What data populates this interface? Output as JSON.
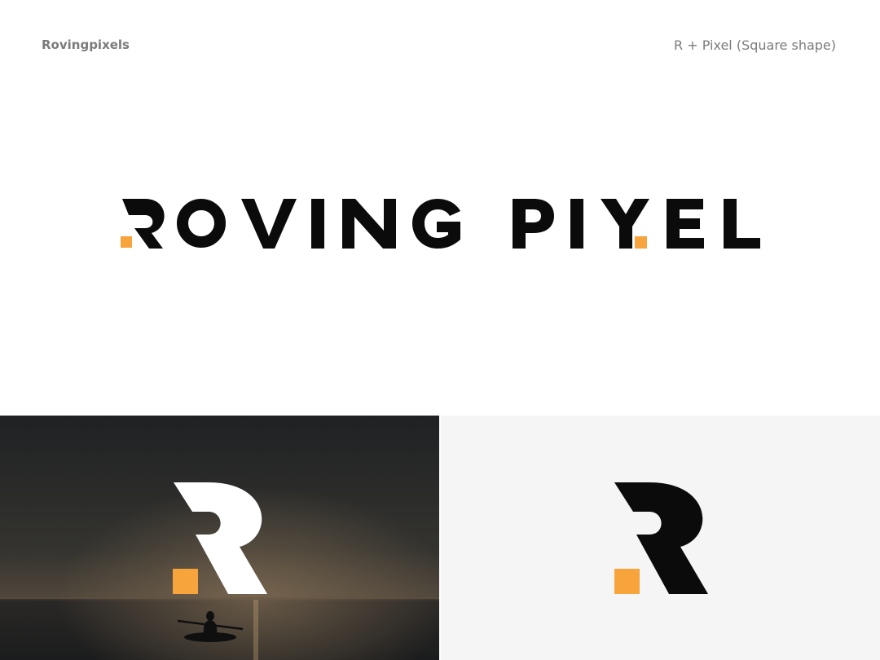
{
  "header": {
    "brand_name": "Rovingpixels",
    "concept_caption": "R + Pixel (Square shape)"
  },
  "logo": {
    "wordmark_letters": [
      "R",
      "O",
      "V",
      "I",
      "N",
      "G",
      "P",
      "I",
      "X",
      "E",
      "L"
    ],
    "monogram": "R"
  },
  "colors": {
    "accent": "#f6a43b",
    "ink": "#0b0b0b",
    "background": "#ffffff",
    "light_panel": "#f5f5f5",
    "caption_gray": "#7b7b7b"
  },
  "icons": {
    "pixel_square": "pixel-square-icon",
    "monogram": "r-monogram-icon"
  }
}
